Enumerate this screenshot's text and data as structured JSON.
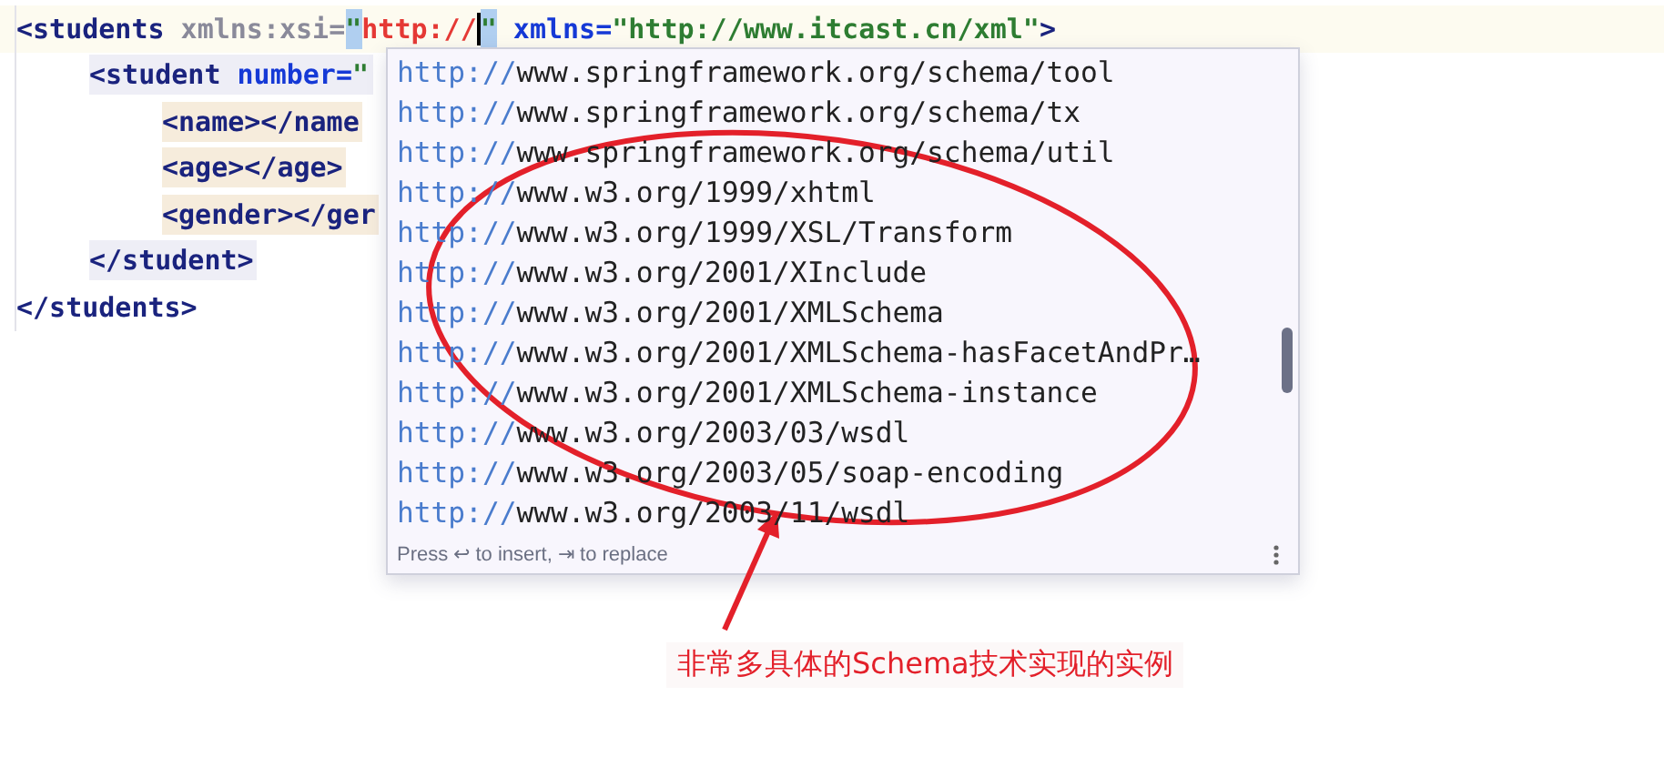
{
  "editor": {
    "lines": [
      {
        "tokens": [
          {
            "kind": "tag",
            "text": "<students"
          },
          {
            "kind": "attr_muted",
            "text": " xmlns:xsi="
          },
          {
            "kind": "quote_hl",
            "text": "\""
          },
          {
            "kind": "value_active",
            "text": "http://"
          },
          {
            "kind": "cursor"
          },
          {
            "kind": "quote_hl",
            "text": "\""
          },
          {
            "kind": "attr",
            "text": " xmlns="
          },
          {
            "kind": "value",
            "text": "\"http://www.itcast.cn/xml\""
          },
          {
            "kind": "tag",
            "text": ">"
          }
        ],
        "children": [
          {
            "tokens": [
              {
                "kind": "tag",
                "text": "<student"
              },
              {
                "kind": "attr",
                "text": " number="
              },
              {
                "kind": "value",
                "text": "\""
              }
            ],
            "children": [
              {
                "tokens": [
                  {
                    "kind": "tag",
                    "text": "<name></name"
                  }
                ]
              },
              {
                "tokens": [
                  {
                    "kind": "tag",
                    "text": "<age></age>"
                  }
                ]
              },
              {
                "tokens": [
                  {
                    "kind": "tag",
                    "text": "<gender></ger"
                  }
                ]
              }
            ]
          },
          {
            "tokens": [
              {
                "kind": "tag",
                "text": "</student>"
              }
            ]
          }
        ]
      },
      {
        "tokens": [
          {
            "kind": "tag",
            "text": "</students>"
          }
        ]
      }
    ]
  },
  "completion_popup": {
    "items": [
      {
        "scheme": "http://",
        "rest": "www.springframework.org/schema/tool"
      },
      {
        "scheme": "http://",
        "rest": "www.springframework.org/schema/tx"
      },
      {
        "scheme": "http://",
        "rest": "www.springframework.org/schema/util"
      },
      {
        "scheme": "http://",
        "rest": "www.w3.org/1999/xhtml"
      },
      {
        "scheme": "http://",
        "rest": "www.w3.org/1999/XSL/Transform"
      },
      {
        "scheme": "http://",
        "rest": "www.w3.org/2001/XInclude"
      },
      {
        "scheme": "http://",
        "rest": "www.w3.org/2001/XMLSchema"
      },
      {
        "scheme": "http://",
        "rest": "www.w3.org/2001/XMLSchema-hasFacetAndPr…"
      },
      {
        "scheme": "http://",
        "rest": "www.w3.org/2001/XMLSchema-instance"
      },
      {
        "scheme": "http://",
        "rest": "www.w3.org/2003/03/wsdl"
      },
      {
        "scheme": "http://",
        "rest": "www.w3.org/2003/05/soap-encoding"
      },
      {
        "scheme": "http://",
        "rest": "www.w3.org/2003/11/wsdl"
      }
    ],
    "footer_hint": "Press ↩ to insert, ⇥ to replace"
  },
  "annotation": {
    "caption": "非常多具体的Schema技术实现的实例"
  }
}
